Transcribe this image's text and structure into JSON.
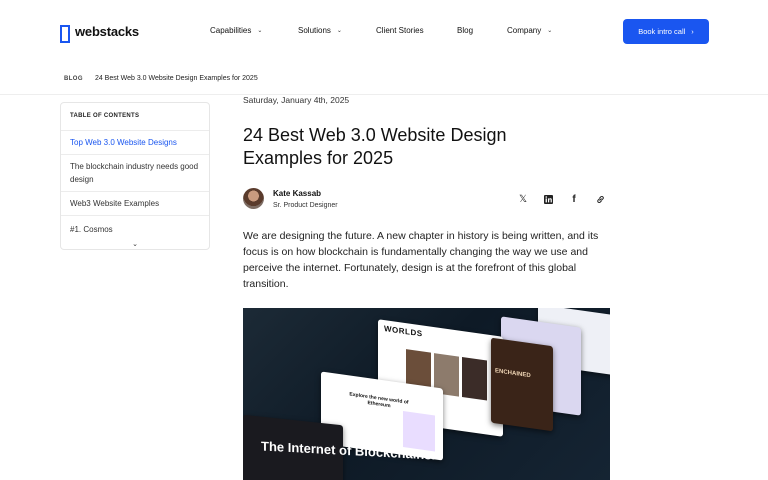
{
  "brand": {
    "name": "webstacks",
    "accent": "#1a56f0"
  },
  "nav": {
    "items": [
      {
        "label": "Capabilities",
        "has_dropdown": true
      },
      {
        "label": "Solutions",
        "has_dropdown": true
      },
      {
        "label": "Client Stories",
        "has_dropdown": false
      },
      {
        "label": "Blog",
        "has_dropdown": false
      },
      {
        "label": "Company",
        "has_dropdown": true
      }
    ],
    "cta_label": "Book intro call",
    "cta_icon": "chevron-right-icon"
  },
  "breadcrumb": {
    "section": "BLOG",
    "current": "24 Best Web 3.0 Website Design Examples for 2025"
  },
  "toc": {
    "heading": "TABLE OF CONTENTS",
    "items": [
      {
        "label": "Top Web 3.0 Website Designs",
        "active": true
      },
      {
        "label": "The blockchain industry needs good design",
        "active": false
      },
      {
        "label": "Web3 Website Examples",
        "active": false
      },
      {
        "label": "#1. Cosmos",
        "active": false
      }
    ],
    "expand_icon": "chevron-down-icon"
  },
  "article": {
    "date": "Saturday, January 4th, 2025",
    "title": "24 Best Web 3.0 Website Design Examples for 2025",
    "author": {
      "name": "Kate Kassab",
      "role": "Sr. Product Designer"
    },
    "share_icons": [
      "x-icon",
      "linkedin-icon",
      "facebook-icon",
      "link-icon"
    ],
    "intro": "We are designing the future. A new chapter in history is being written, and its focus is on how blockchain is fundamentally changing the way we use and perceive the internet. Fortunately, design is at the forefront of this global transition.",
    "hero": {
      "headline": "The Internet of Blockchains.",
      "card_texts": [
        "Explore the new world of Ethereum",
        "WORLDS",
        "ENCHAINED"
      ]
    }
  }
}
